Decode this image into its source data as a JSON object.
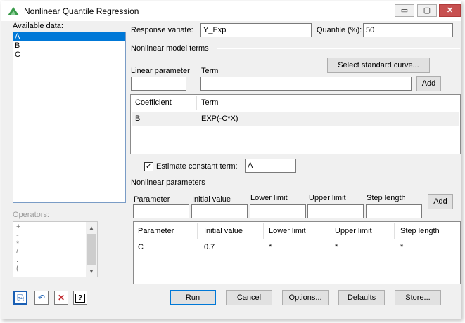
{
  "window": {
    "title": "Nonlinear Quantile Regression",
    "controls": {
      "minimize": "▭",
      "maximize": "▢",
      "close": "✕"
    }
  },
  "available_data": {
    "label": "Available data:",
    "items": [
      "A",
      "B",
      "C"
    ],
    "selected": "A"
  },
  "operators": {
    "label": "Operators:",
    "items": [
      "+",
      "-",
      "*",
      "/",
      ".",
      "("
    ]
  },
  "response": {
    "label": "Response variate:",
    "value": "Y_Exp"
  },
  "quantile": {
    "label": "Quantile (%):",
    "value": "50"
  },
  "model_terms": {
    "group_label": "Nonlinear model terms",
    "linear_param_label": "Linear parameter",
    "linear_param_value": "",
    "term_label": "Term",
    "term_value": "",
    "select_curve_button": "Select standard curve...",
    "add_button": "Add",
    "grid": {
      "headers": [
        "Coefficient",
        "Term"
      ],
      "rows": [
        [
          "B",
          "EXP(-C*X)"
        ]
      ]
    }
  },
  "constant": {
    "label": "Estimate constant term:",
    "checked": true,
    "check_mark": "✓",
    "value": "A"
  },
  "params": {
    "group_label": "Nonlinear parameters",
    "field_labels": {
      "parameter": "Parameter",
      "initial": "Initial value",
      "lower": "Lower limit",
      "upper": "Upper limit",
      "step": "Step length"
    },
    "add_button": "Add",
    "grid": {
      "headers": [
        "Parameter",
        "Initial value",
        "Lower limit",
        "Upper limit",
        "Step length"
      ],
      "rows": [
        [
          "C",
          "0.7",
          "*",
          "*",
          "*"
        ]
      ]
    }
  },
  "toolbar": {
    "icons": [
      "paste-icon",
      "undo-icon",
      "clear-icon",
      "help-icon"
    ],
    "glyphs": {
      "paste": "⎘",
      "undo": "↶",
      "clear": "✕",
      "help": "?"
    }
  },
  "buttons": {
    "run": "Run",
    "cancel": "Cancel",
    "options": "Options...",
    "defaults": "Defaults",
    "store": "Store..."
  },
  "colors": {
    "selection": "#0078d7",
    "close_button": "#c75050",
    "app_icon": "#3a9b4a"
  }
}
